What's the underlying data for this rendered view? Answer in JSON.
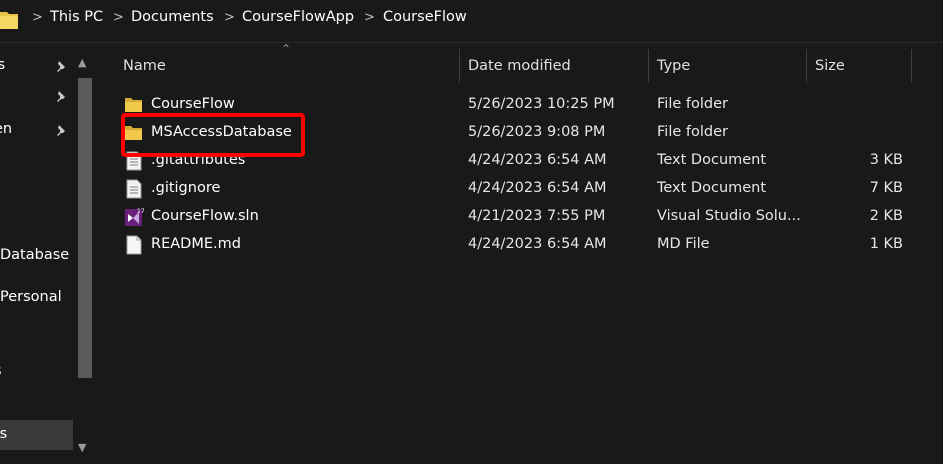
{
  "breadcrumb": {
    "items": [
      "This PC",
      "Documents",
      "CourseFlowApp",
      "CourseFlow"
    ],
    "separator": ">"
  },
  "nav": {
    "items": [
      "ts",
      "",
      "en",
      "",
      "Database",
      "Personal",
      "s",
      "ts"
    ]
  },
  "columns": {
    "name": "Name",
    "date": "Date modified",
    "type": "Type",
    "size": "Size"
  },
  "files": [
    {
      "name": "CourseFlow",
      "date": "5/26/2023 10:25 PM",
      "type": "File folder",
      "size": "",
      "icon": "folder-icon"
    },
    {
      "name": "MSAccessDatabase",
      "date": "5/26/2023 9:08 PM",
      "type": "File folder",
      "size": "",
      "icon": "folder-icon"
    },
    {
      "name": ".gitattributes",
      "date": "4/24/2023 6:54 AM",
      "type": "Text Document",
      "size": "3 KB",
      "icon": "text-file-icon"
    },
    {
      "name": ".gitignore",
      "date": "4/24/2023 6:54 AM",
      "type": "Text Document",
      "size": "7 KB",
      "icon": "text-file-icon"
    },
    {
      "name": "CourseFlow.sln",
      "date": "4/21/2023 7:55 PM",
      "type": "Visual Studio Solu...",
      "size": "2 KB",
      "icon": "visual-studio-solution-icon"
    },
    {
      "name": "README.md",
      "date": "4/24/2023 6:54 AM",
      "type": "MD File",
      "size": "1 KB",
      "icon": "file-icon"
    }
  ],
  "colors": {
    "background": "#191919",
    "highlight": "#ff0000",
    "folder": "#e8c34a"
  }
}
